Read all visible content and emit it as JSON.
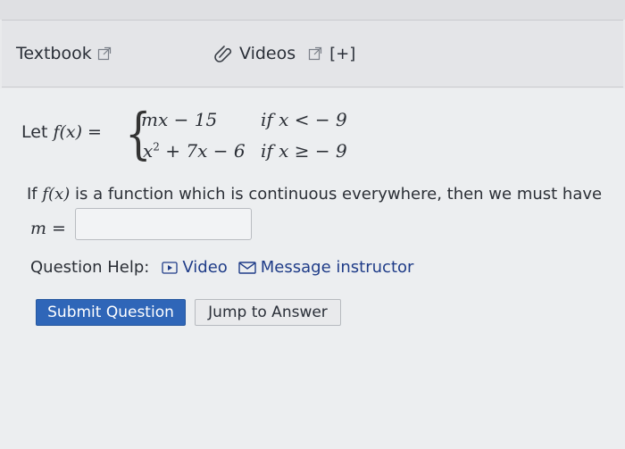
{
  "resources": {
    "textbook_label": "Textbook",
    "videos_label": "Videos",
    "expand_label": "[+]"
  },
  "problem": {
    "let_prefix": "Let",
    "function_lhs": "f(x) =",
    "case1_expr": "mx − 15",
    "case1_cond": "if  x <  − 9",
    "case2_expr_base": "x",
    "case2_expr_sup": "2",
    "case2_expr_rest": " + 7x − 6",
    "case2_cond": "if  x ≥  − 9",
    "statement_prefix": "If",
    "statement_fx": "f(x)",
    "statement_suffix": "is a function which is continuous everywhere, then we must have",
    "answer_label": "m =",
    "answer_value": ""
  },
  "help": {
    "label": "Question Help:",
    "video_label": "Video",
    "message_label": "Message instructor"
  },
  "buttons": {
    "submit_label": "Submit Question",
    "jump_label": "Jump to Answer"
  },
  "colors": {
    "submit_bg": "#2f66b8",
    "link": "#1f3c88",
    "page_bg": "#eceef0"
  }
}
